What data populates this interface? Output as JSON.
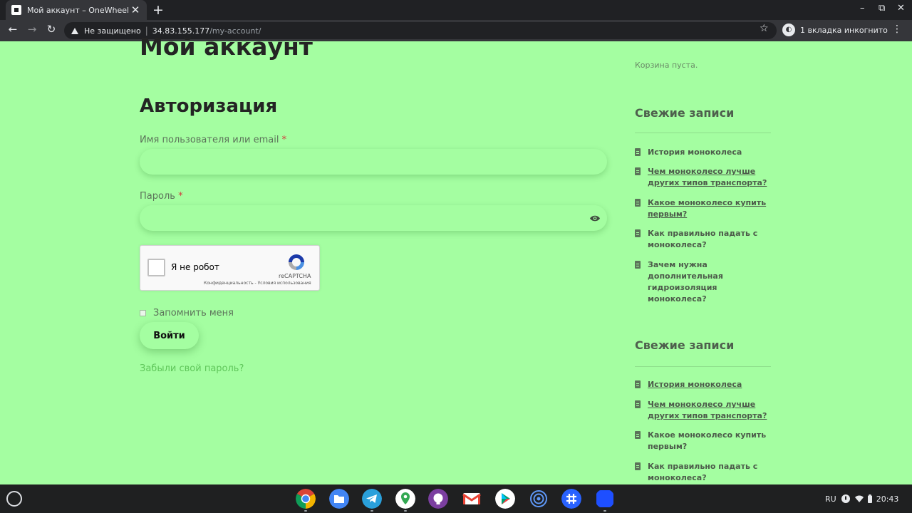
{
  "browser": {
    "tab_title": "Мой аккаунт – OneWheel",
    "tab_close": "✕",
    "new_tab": "+",
    "window_controls": {
      "minimize": "–",
      "maximize": "⧉",
      "close": "✕"
    },
    "nav": {
      "back": "←",
      "forward": "→",
      "reload": "↻"
    },
    "security_label": "Не защищено",
    "separator": "|",
    "url_host": "34.83.155.177",
    "url_path": "/my-account/",
    "bookmark_icon": "☆",
    "incognito_label": "1 вкладка инкогнито",
    "menu_icon": "⋮"
  },
  "page": {
    "title": "Мой аккаунт",
    "section_title": "Авторизация",
    "username_label": "Имя пользователя или email",
    "password_label": "Пароль",
    "required_mark": "*",
    "username_value": "",
    "password_value": "",
    "captcha_label": "Я не робот",
    "captcha_brand": "reCAPTCHA",
    "captcha_terms": "Конфиденциальность - Условия использования",
    "remember_label": "Запомнить меня",
    "login_button": "Войти",
    "forgot_link": "Забыли свой пароль?"
  },
  "sidebar": {
    "cart_empty": "Корзина пуста.",
    "widgets": [
      {
        "title": "Свежие записи",
        "posts": [
          "История моноколеса",
          "Чем моноколесо лучше других типов транспорта?",
          "Какое моноколесо купить первым?",
          "Как правильно падать с моноколеса?",
          "Зачем нужна дополнительная гидроизоляция моноколеса?"
        ]
      },
      {
        "title": "Свежие записи",
        "posts": [
          "История моноколеса",
          "Чем моноколесо лучше других типов транспорта?",
          "Какое моноколесо купить первым?",
          "Как правильно падать с моноколеса?"
        ]
      }
    ]
  },
  "shelf": {
    "apps": [
      "chrome-icon",
      "files-icon",
      "telegram-icon",
      "maps-icon",
      "github-icon",
      "gmail-icon",
      "play-store-icon",
      "cast-icon",
      "hashtag-app-icon",
      "blue-app-icon"
    ],
    "tray": {
      "language": "RU",
      "time": "20:43"
    }
  },
  "colors": {
    "page_background": "#a4fea1",
    "accent_link": "#5fc65a",
    "required": "#d23c3c"
  }
}
